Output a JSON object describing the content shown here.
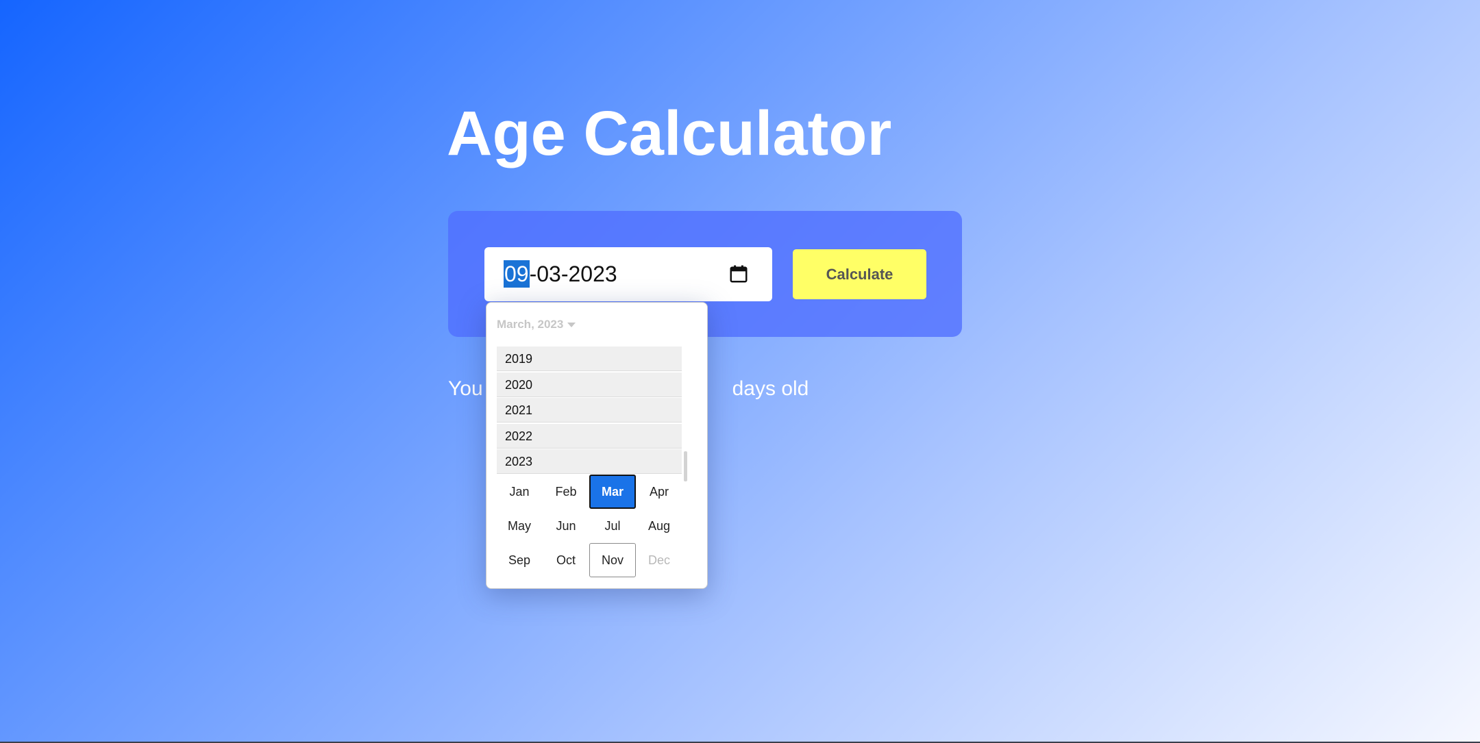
{
  "page": {
    "title": "Age Calculator"
  },
  "form": {
    "date_day": "09",
    "date_sep1": "-",
    "date_month": "03",
    "date_sep2": "-",
    "date_year": "2023",
    "calculate_label": "Calculate",
    "calendar_icon": "calendar-icon"
  },
  "result": {
    "prefix": "You",
    "suffix": "days old"
  },
  "picker": {
    "header": "March, 2023",
    "years": [
      "2019",
      "2020",
      "2021",
      "2022",
      "2023"
    ],
    "months": [
      "Jan",
      "Feb",
      "Mar",
      "Apr",
      "May",
      "Jun",
      "Jul",
      "Aug",
      "Sep",
      "Oct",
      "Nov",
      "Dec"
    ],
    "selected_month": "Mar",
    "current_month": "Nov",
    "disabled_months": [
      "Dec"
    ]
  },
  "colors": {
    "accent": "#1a73e8",
    "button": "#ffff66",
    "card": "#506eff"
  }
}
